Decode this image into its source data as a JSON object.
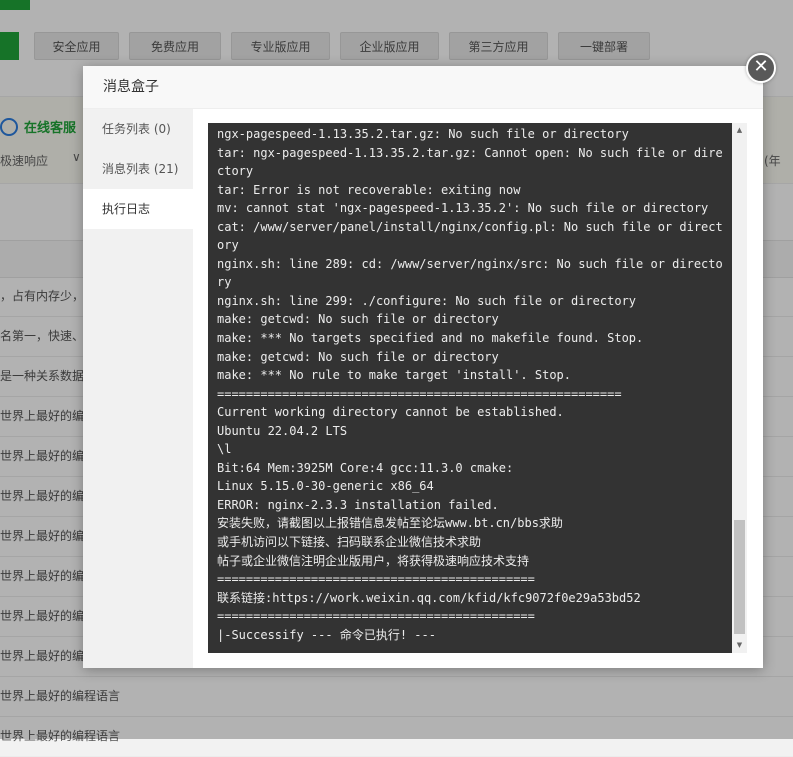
{
  "background": {
    "tabs": [
      "安全应用",
      "免费应用",
      "专业版应用",
      "企业版应用",
      "第三方应用",
      "一键部署"
    ],
    "service_title": "在线客服",
    "service_sub": "极速响应",
    "service_right": "(年",
    "rows": [
      "，占有内存少，支",
      "名第一，快速、可",
      "是一种关系数据库",
      "世界上最好的编程",
      "世界上最好的编程",
      "世界上最好的编程",
      "世界上最好的编程",
      "世界上最好的编程",
      "世界上最好的编程",
      "世界上最好的编程",
      "世界上最好的编程语言",
      "世界上最好的编程语言"
    ]
  },
  "modal": {
    "title": "消息盒子",
    "close_symbol": "✕",
    "sidebar": [
      {
        "label": "任务列表 (0)"
      },
      {
        "label": "消息列表 (21)"
      },
      {
        "label": "执行日志"
      }
    ],
    "log_lines": [
      "ngx-pagespeed-1.13.35.2.tar.gz: No such file or directory",
      "tar: ngx-pagespeed-1.13.35.2.tar.gz: Cannot open: No such file or directory",
      "tar: Error is not recoverable: exiting now",
      "mv: cannot stat 'ngx-pagespeed-1.13.35.2': No such file or directory",
      "cat: /www/server/panel/install/nginx/config.pl: No such file or directory",
      "nginx.sh: line 289: cd: /www/server/nginx/src: No such file or directory",
      "nginx.sh: line 299: ./configure: No such file or directory",
      "make: getcwd: No such file or directory",
      "make: *** No targets specified and no makefile found. Stop.",
      "make: getcwd: No such file or directory",
      "make: *** No rule to make target 'install'. Stop.",
      "========================================================",
      "Current working directory cannot be established.",
      "Ubuntu 22.04.2 LTS",
      "\\l",
      "Bit:64 Mem:3925M Core:4 gcc:11.3.0 cmake:",
      "Linux 5.15.0-30-generic x86_64",
      "ERROR: nginx-2.3.3 installation failed.",
      "安装失败，请截图以上报错信息发帖至论坛www.bt.cn/bbs求助",
      "或手机访问以下链接、扫码联系企业微信技术求助",
      "帖子或企业微信注明企业版用户，将获得极速响应技术支持",
      "============================================",
      "联系链接:https://work.weixin.qq.com/kfid/kfc9072f0e29a53bd52",
      "============================================",
      "|-Successify --- 命令已执行! ---"
    ]
  }
}
